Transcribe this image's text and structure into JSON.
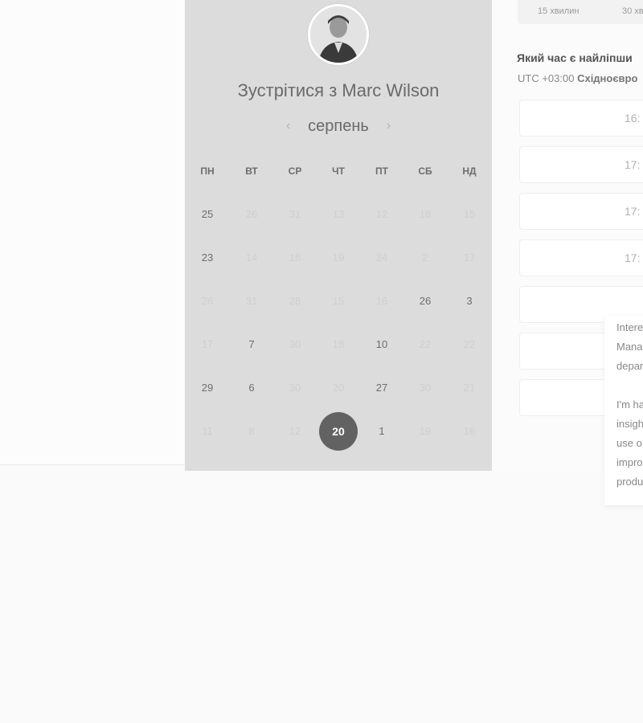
{
  "header": {
    "title": "Зустрітися з Marc Wilson",
    "month": "серпень",
    "prev_icon": "chevron-left-icon",
    "next_icon": "chevron-right-icon"
  },
  "weekdays": [
    "ПН",
    "ВТ",
    "СР",
    "ЧТ",
    "ПТ",
    "СБ",
    "НД"
  ],
  "calendar_rows": [
    [
      {
        "t": "25",
        "s": "active"
      },
      {
        "t": "26",
        "s": "dim"
      },
      {
        "t": "31",
        "s": "dim"
      },
      {
        "t": "13",
        "s": "dim"
      },
      {
        "t": "12",
        "s": "dim"
      },
      {
        "t": "18",
        "s": "dim"
      },
      {
        "t": "15",
        "s": "dim"
      }
    ],
    [
      {
        "t": "23",
        "s": "active"
      },
      {
        "t": "14",
        "s": "dim"
      },
      {
        "t": "18",
        "s": "dim"
      },
      {
        "t": "19",
        "s": "dim"
      },
      {
        "t": "24",
        "s": "dim"
      },
      {
        "t": "2",
        "s": "dim"
      },
      {
        "t": "17",
        "s": "dim"
      }
    ],
    [
      {
        "t": "26",
        "s": "dim"
      },
      {
        "t": "31",
        "s": "dim"
      },
      {
        "t": "28",
        "s": "dim"
      },
      {
        "t": "15",
        "s": "dim"
      },
      {
        "t": "16",
        "s": "dim"
      },
      {
        "t": "26",
        "s": "active"
      },
      {
        "t": "3",
        "s": "active"
      }
    ],
    [
      {
        "t": "17",
        "s": "dim"
      },
      {
        "t": "7",
        "s": "active"
      },
      {
        "t": "30",
        "s": "dim"
      },
      {
        "t": "18",
        "s": "dim"
      },
      {
        "t": "10",
        "s": "active"
      },
      {
        "t": "22",
        "s": "dim"
      },
      {
        "t": "22",
        "s": "dim"
      }
    ],
    [
      {
        "t": "29",
        "s": "active"
      },
      {
        "t": "6",
        "s": "active"
      },
      {
        "t": "30",
        "s": "dim"
      },
      {
        "t": "20",
        "s": "dim"
      },
      {
        "t": "27",
        "s": "active"
      },
      {
        "t": "30",
        "s": "dim"
      },
      {
        "t": "21",
        "s": "dim"
      }
    ],
    [
      {
        "t": "11",
        "s": "dim"
      },
      {
        "t": "8",
        "s": "dim"
      },
      {
        "t": "12",
        "s": "dim"
      },
      {
        "t": "20",
        "s": "selected"
      },
      {
        "t": "1",
        "s": "active"
      },
      {
        "t": "19",
        "s": "dim"
      },
      {
        "t": "16",
        "s": "dim"
      }
    ]
  ],
  "durations": [
    "15 хвилин",
    "30 хв"
  ],
  "question": "Який час є найліпши",
  "timezone": {
    "offset": "UTC +03:00",
    "name": "Східноєвро"
  },
  "time_slots": [
    "16:",
    "17:",
    "17:",
    "17:",
    "",
    "",
    ""
  ],
  "note_lines": [
    "Intere",
    "Mana",
    "depar",
    "",
    "I'm ha",
    "insigh",
    "use o",
    "impro",
    "produ"
  ]
}
